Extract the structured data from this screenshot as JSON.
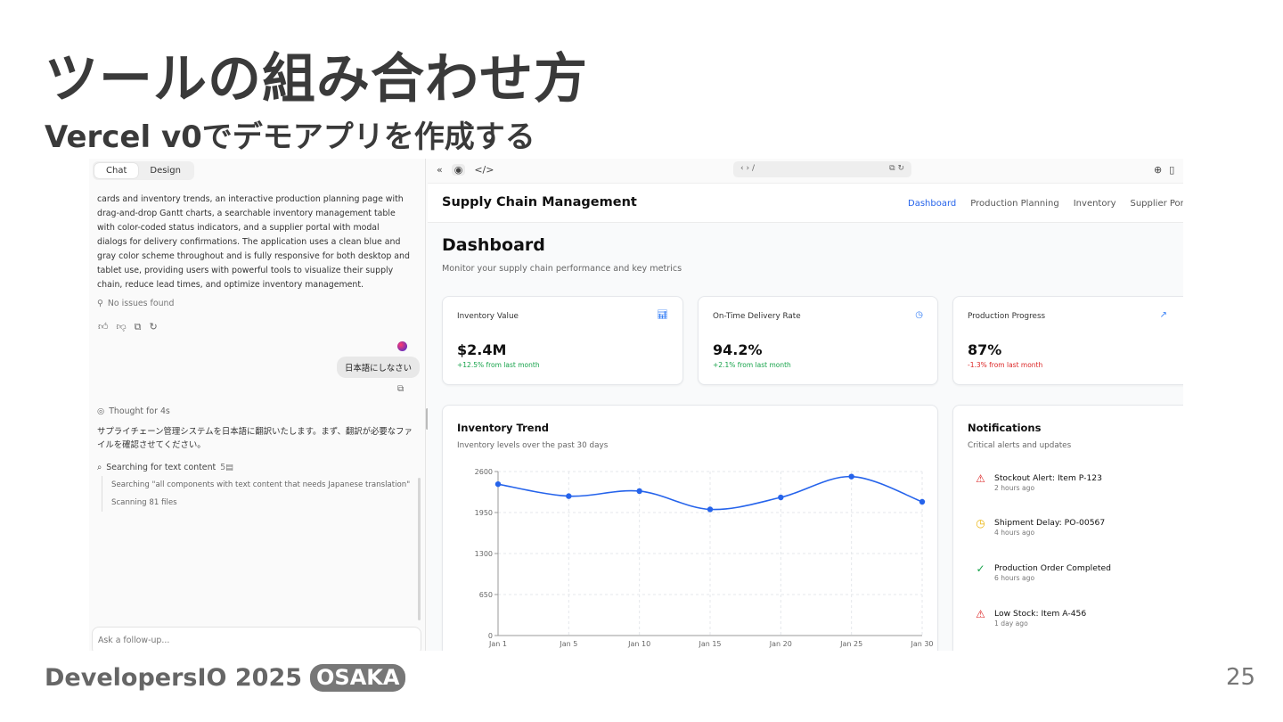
{
  "slide": {
    "title": "ツールの組み合わせ方",
    "subtitle": "Vercel v0でデモアプリを作成する",
    "footer_brand": "DevelopersIO 2025",
    "footer_badge": "OSAKA",
    "page_number": "25"
  },
  "chat": {
    "tabs": [
      "Chat",
      "Design"
    ],
    "message": "cards and inventory trends, an interactive production planning page with drag-and-drop Gantt charts, a searchable inventory management table with color-coded status indicators, and a supplier portal with modal dialogs for delivery confirmations. The application uses a clean blue and gray color scheme throughout and is fully responsive for both desktop and tablet use, providing users with powerful tools to visualize their supply chain, reduce lead times, and optimize inventory management.",
    "no_issues": "No issues found",
    "user_message": "日本語にしなさい",
    "thought": "Thought for 4s",
    "assistant_jp": "サプライチェーン管理システムを日本語に翻訳いたします。まず、翻訳が必要なファイルを確認させてください。",
    "search_label": "Searching for text content",
    "search_count": "5",
    "search_detail": "Searching \"all components with text content that needs Japanese translation\"",
    "scanning": "Scanning 81 files",
    "follow_up_placeholder": "Ask a follow-up..."
  },
  "preview": {
    "url": "/",
    "brand": "Supply Chain Management",
    "nav": [
      "Dashboard",
      "Production Planning",
      "Inventory",
      "Supplier Por"
    ],
    "page_title": "Dashboard",
    "page_desc": "Monitor your supply chain performance and key metrics",
    "kpis": [
      {
        "label": "Inventory Value",
        "value": "$2.4M",
        "delta": "+12.5% from last month",
        "trend": "positive",
        "icon": "bar-chart-icon"
      },
      {
        "label": "On-Time Delivery Rate",
        "value": "94.2%",
        "delta": "+2.1% from last month",
        "trend": "positive",
        "icon": "clock-icon"
      },
      {
        "label": "Production Progress",
        "value": "87%",
        "delta": "-1.3% from last month",
        "trend": "negative",
        "icon": "trending-up-icon"
      }
    ],
    "chart_title": "Inventory Trend",
    "chart_sub": "Inventory levels over the past 30 days",
    "notifications_title": "Notifications",
    "notifications_sub": "Critical alerts and updates",
    "notifications": [
      {
        "title": "Stockout Alert: Item P-123",
        "time": "2 hours ago",
        "icon": "alert-triangle-icon",
        "color": "#dc2626"
      },
      {
        "title": "Shipment Delay: PO-00567",
        "time": "4 hours ago",
        "icon": "clock-icon",
        "color": "#eab308"
      },
      {
        "title": "Production Order Completed",
        "time": "6 hours ago",
        "icon": "check-circle-icon",
        "color": "#16a34a"
      },
      {
        "title": "Low Stock: Item A-456",
        "time": "1 day ago",
        "icon": "alert-triangle-icon",
        "color": "#dc2626"
      }
    ]
  },
  "chart_data": {
    "type": "line",
    "x": [
      "Jan 1",
      "Jan 5",
      "Jan 10",
      "Jan 15",
      "Jan 20",
      "Jan 25",
      "Jan 30"
    ],
    "series": [
      {
        "values": [
          2400,
          2210,
          2290,
          2000,
          2190,
          2520,
          2120
        ]
      }
    ],
    "y_ticks": [
      0,
      650,
      1300,
      1950,
      2600
    ],
    "ylim": [
      0,
      2600
    ],
    "grid": true,
    "color": "#2563eb"
  }
}
